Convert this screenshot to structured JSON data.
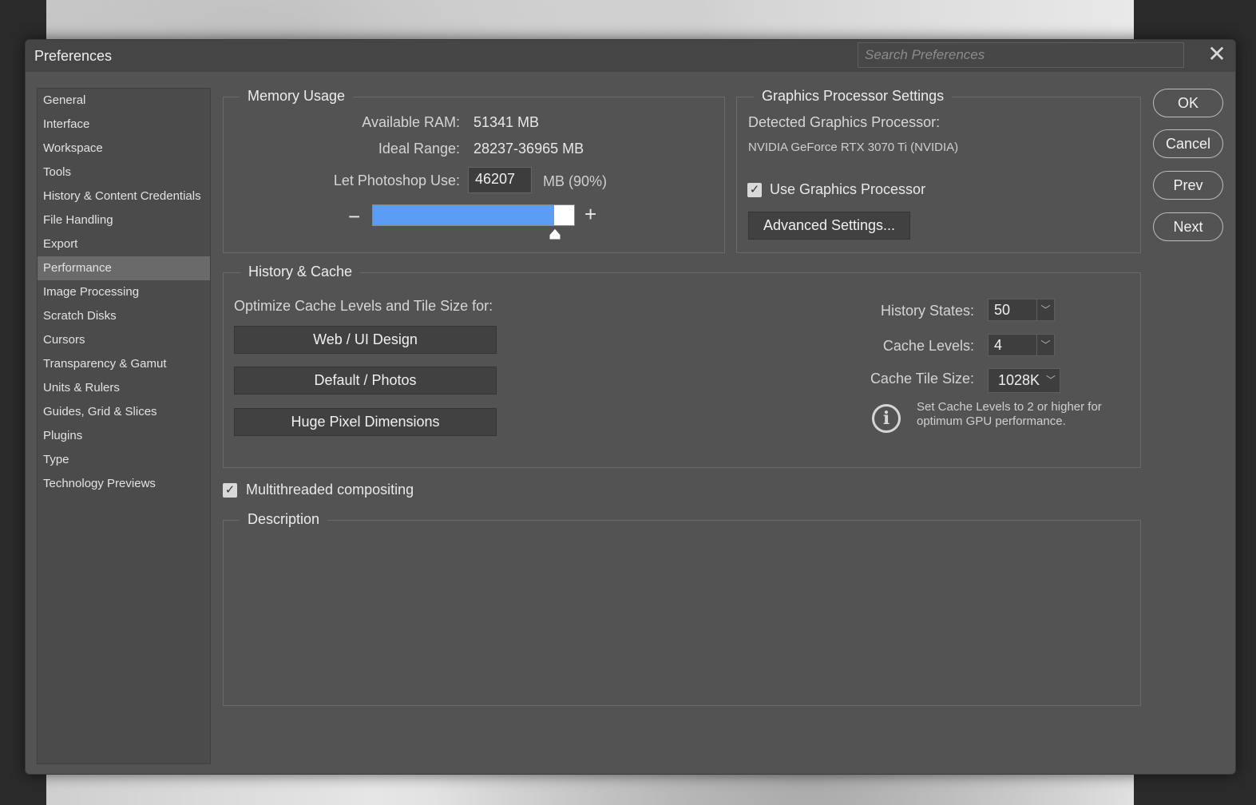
{
  "window": {
    "title": "Preferences",
    "search_placeholder": "Search Preferences",
    "close_glyph": "✕"
  },
  "sidebar": {
    "items": [
      {
        "label": "General"
      },
      {
        "label": "Interface"
      },
      {
        "label": "Workspace"
      },
      {
        "label": "Tools"
      },
      {
        "label": "History & Content Credentials"
      },
      {
        "label": "File Handling"
      },
      {
        "label": "Export"
      },
      {
        "label": "Performance",
        "active": true
      },
      {
        "label": "Image Processing"
      },
      {
        "label": "Scratch Disks"
      },
      {
        "label": "Cursors"
      },
      {
        "label": "Transparency & Gamut"
      },
      {
        "label": "Units & Rulers"
      },
      {
        "label": "Guides, Grid & Slices"
      },
      {
        "label": "Plugins"
      },
      {
        "label": "Type"
      },
      {
        "label": "Technology Previews"
      }
    ]
  },
  "memory": {
    "legend": "Memory Usage",
    "available_label": "Available RAM:",
    "available_value": "51341 MB",
    "ideal_label": "Ideal Range:",
    "ideal_value": "28237-36965 MB",
    "use_label": "Let Photoshop Use:",
    "use_value": "46207",
    "use_unit": "MB (90%)",
    "slider_fraction": 0.9,
    "minus": "−",
    "plus": "+"
  },
  "gpu": {
    "legend": "Graphics Processor Settings",
    "detected_label": "Detected Graphics Processor:",
    "detected_value": "NVIDIA GeForce RTX 3070 Ti (NVIDIA)",
    "use_gpu_label": "Use Graphics Processor",
    "use_gpu_checked": true,
    "advanced_button": "Advanced Settings..."
  },
  "cache": {
    "legend": "History & Cache",
    "optimize_label": "Optimize Cache Levels and Tile Size for:",
    "buttons": [
      "Web / UI Design",
      "Default / Photos",
      "Huge Pixel Dimensions"
    ],
    "history_states_label": "History States:",
    "history_states_value": "50",
    "cache_levels_label": "Cache Levels:",
    "cache_levels_value": "4",
    "tile_size_label": "Cache Tile Size:",
    "tile_size_value": "1028K",
    "info_line1": "Set Cache Levels to 2 or higher for",
    "info_line2": "optimum GPU performance.",
    "info_glyph": "i"
  },
  "multithreaded": {
    "label": "Multithreaded compositing",
    "checked": true
  },
  "description": {
    "legend": "Description"
  },
  "actions": {
    "ok": "OK",
    "cancel": "Cancel",
    "prev": "Prev",
    "next": "Next"
  },
  "colors": {
    "accent": "#5b9cf5",
    "dialog_bg": "#535353",
    "sidebar_active": "#6a6a6a"
  }
}
